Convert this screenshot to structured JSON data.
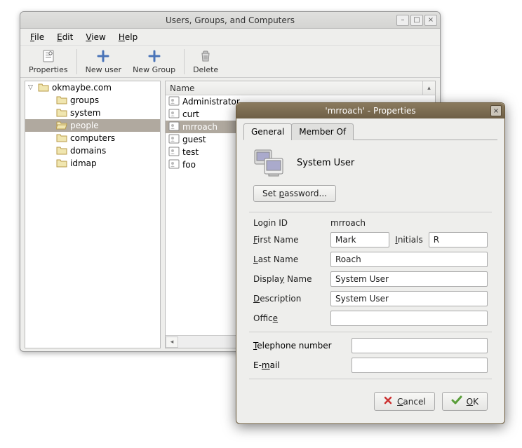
{
  "mainWindow": {
    "title": "Users, Groups, and Computers",
    "menus": [
      "File",
      "Edit",
      "View",
      "Help"
    ],
    "toolbar": {
      "properties": "Properties",
      "newUser": "New user",
      "newGroup": "New Group",
      "delete": "Delete"
    },
    "tree": {
      "root": "okmaybe.com",
      "children": [
        "groups",
        "system",
        "people",
        "computers",
        "domains",
        "idmap"
      ],
      "selected": "people"
    },
    "list": {
      "header": "Name",
      "items": [
        "Administrator",
        "curt",
        "mrroach",
        "guest",
        "test",
        "foo"
      ],
      "selected": "mrroach"
    }
  },
  "dialog": {
    "title": "'mrroach' - Properties",
    "tabs": {
      "general": "General",
      "memberOf": "Member Of",
      "active": "general"
    },
    "heading": "System User",
    "setPassword": "Set password...",
    "labels": {
      "loginId": "Login ID",
      "firstName": "First Name",
      "initials": "Initials",
      "lastName": "Last Name",
      "displayName": "Display Name",
      "description": "Description",
      "office": "Office",
      "telephone": "Telephone number",
      "email": "E-mail"
    },
    "values": {
      "loginId": "mrroach",
      "firstName": "Mark",
      "initials": "R",
      "lastName": "Roach",
      "displayName": "System User",
      "description": "System User",
      "office": "",
      "telephone": "",
      "email": ""
    },
    "buttons": {
      "cancel": "Cancel",
      "ok": "OK"
    }
  }
}
